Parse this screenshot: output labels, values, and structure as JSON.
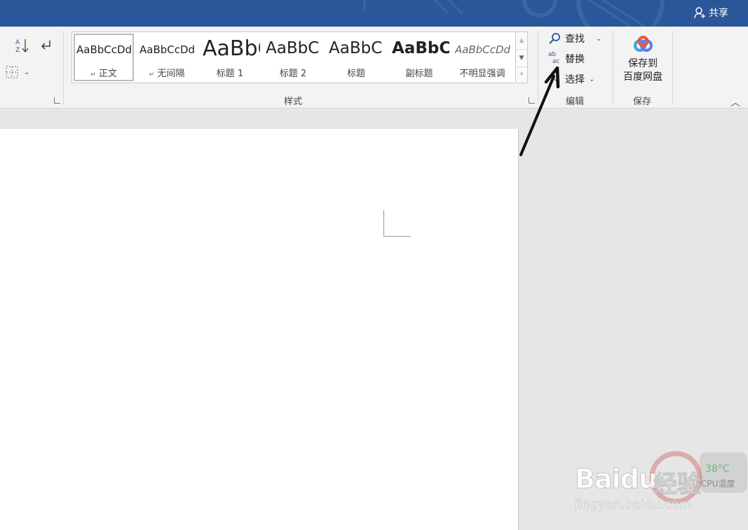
{
  "titlebar": {
    "share_label": "共享",
    "bg_color": "#2b579a"
  },
  "ribbon": {
    "paragraph_icons": [
      "sort-az-icon",
      "show-marks-icon",
      "borders-icon"
    ],
    "styles": {
      "group_label": "样式",
      "items": [
        {
          "preview": "AaBbCcDd",
          "name": "正文",
          "selected": true
        },
        {
          "preview": "AaBbCcDd",
          "name": "无间隔",
          "selected": false
        },
        {
          "preview": "AaBbC",
          "name": "标题 1",
          "selected": false
        },
        {
          "preview": "AaBbC",
          "name": "标题 2",
          "selected": false
        },
        {
          "preview": "AaBbC",
          "name": "标题",
          "selected": false
        },
        {
          "preview": "AaBbC",
          "name": "副标题",
          "selected": false
        },
        {
          "preview": "AaBbCcDd",
          "name": "不明显强调",
          "selected": false
        }
      ]
    },
    "editing": {
      "group_label": "编辑",
      "find_label": "查找",
      "replace_label": "替换",
      "replace_icon_text_top": "ab",
      "replace_icon_text_bottom": "ac",
      "select_label": "选择"
    },
    "save": {
      "group_label": "保存",
      "button_label_line1": "保存到",
      "button_label_line2": "百度网盘"
    }
  },
  "watermark": {
    "brand_left": "Bai",
    "brand_mid": "du",
    "brand_cn": "经验",
    "url": "jingyan.baidu.com",
    "temp": "38°C",
    "cpu_label": "CPU温度"
  }
}
